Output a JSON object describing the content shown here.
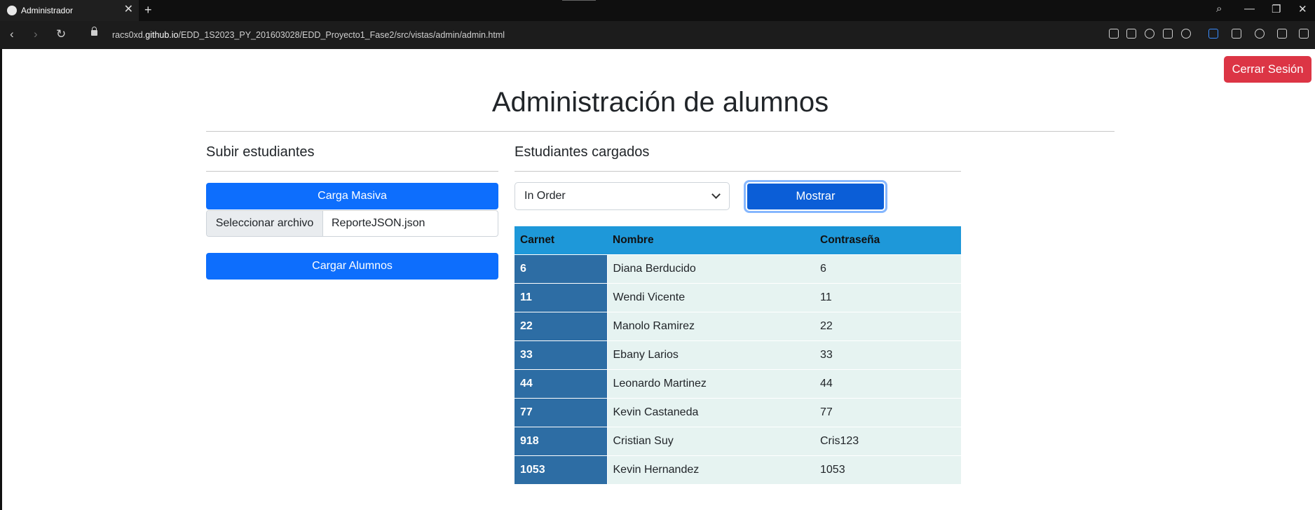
{
  "browser": {
    "tab_title": "Administrador",
    "new_tab": "+",
    "url_prefix": "racs0xd.",
    "url_domain": "github.io",
    "url_path": "/EDD_1S2023_PY_201603028/EDD_Proyecto1_Fase2/src/vistas/admin/admin.html",
    "back_glyph": "‹",
    "forward_glyph": "›",
    "reload_glyph": "↻",
    "close_glyph": "✕",
    "minimize_glyph": "—",
    "restore_glyph": "❐",
    "search_glyph": "⌕"
  },
  "header": {
    "logout_label": "Cerrar Sesión",
    "title": "Administración de alumnos"
  },
  "upload": {
    "section_title": "Subir estudiantes",
    "bulk_label": "Carga Masiva",
    "file_button": "Seleccionar archivo",
    "file_name": "ReporteJSON.json",
    "submit_label": "Cargar Alumnos"
  },
  "students": {
    "section_title": "Estudiantes cargados",
    "order_selected": "In Order",
    "show_label": "Mostrar",
    "columns": [
      "Carnet",
      "Nombre",
      "Contraseña"
    ],
    "rows": [
      [
        "6",
        "Diana Berducido",
        "6"
      ],
      [
        "11",
        "Wendi Vicente",
        "11"
      ],
      [
        "22",
        "Manolo Ramirez",
        "22"
      ],
      [
        "33",
        "Ebany Larios",
        "33"
      ],
      [
        "44",
        "Leonardo Martinez",
        "44"
      ],
      [
        "77",
        "Kevin Castaneda",
        "77"
      ],
      [
        "918",
        "Cristian Suy",
        "Cris123"
      ],
      [
        "1053",
        "Kevin Hernandez",
        "1053"
      ]
    ]
  },
  "colors": {
    "danger": "#dc3545",
    "primary": "#0d6efd",
    "table_header": "#1e98d9",
    "carnet_cell": "#2d6da4",
    "row_bg": "#e6f3f1"
  }
}
